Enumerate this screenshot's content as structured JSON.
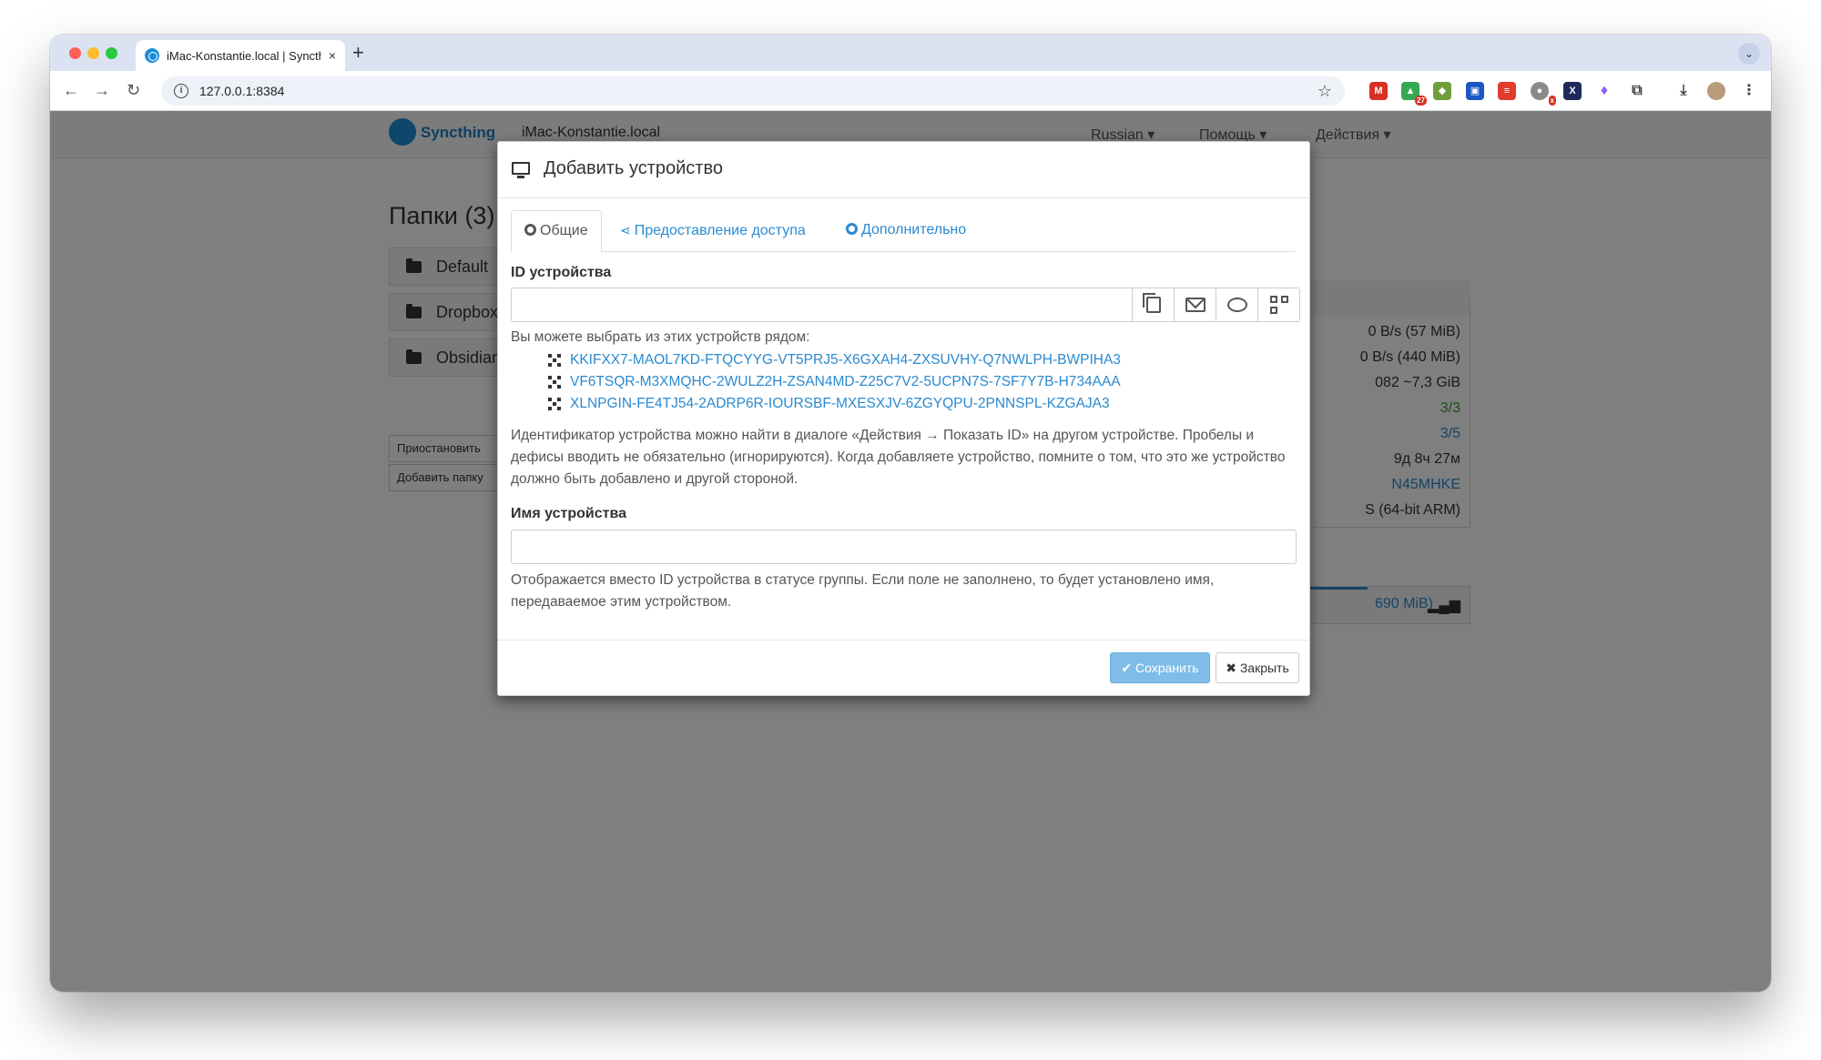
{
  "browser": {
    "tab_title": "iMac-Konstantie.local | Syncthing",
    "url": "127.0.0.1:8384",
    "new_tab": "+",
    "tab_close": "×",
    "ext_badge_count": "27",
    "ext_badge_x": "x"
  },
  "app": {
    "brand": "Syncthing",
    "host": "iMac-Konstantie.local",
    "menu_language": "Russian ▾",
    "menu_help": "Помощь ▾",
    "menu_actions": "Действия ▾",
    "folders_heading": "Папки (3)",
    "folders": [
      "Default",
      "Dropbox",
      "Obsidian"
    ],
    "pause_btn": "Приостановить",
    "add_folder_btn": "Добавить папку"
  },
  "right_panel": {
    "download": "0 B/s (57 MiB)",
    "upload": "0 B/s (440 MiB)",
    "local_state": "082  ~7,3 GiB",
    "listeners": "3/3",
    "discovery": "3/5",
    "uptime": "9д 8ч 27м",
    "id": "N45MHKE",
    "version": "S (64-bit ARM)",
    "device_summary": "690 MiB)"
  },
  "modal": {
    "title": "Добавить устройство",
    "tabs": [
      "Общие",
      "Предоставление доступа",
      "Дополнительно"
    ],
    "device_id_label": "ID устройства",
    "device_id_value": "",
    "nearby_intro": "Вы можете выбрать из этих устройств рядом:",
    "nearby_devices": [
      "KKIFXX7-MAOL7KD-FTQCYYG-VT5PRJ5-X6GXAH4-ZXSUVHY-Q7NWLPH-BWPIHA3",
      "VF6TSQR-M3XMQHC-2WULZ2H-ZSAN4MD-Z25C7V2-5UCPN7S-7SF7Y7B-H734AAA",
      "XLNPGIN-FE4TJ54-2ADRP6R-IOURSBF-MXESXJV-6ZGYQPU-2PNNSPL-KZGAJA3"
    ],
    "device_id_help": "Идентификатор устройства можно найти в диалоге «Действия → Показать ID» на другом устройстве. Пробелы и дефисы вводить не обязательно (игнорируются). Когда добавляете устройство, помните о том, что это же устройство должно быть добавлено и другой стороной.",
    "device_name_label": "Имя устройства",
    "device_name_value": "",
    "device_name_help": "Отображается вместо ID устройства в статусе группы. Если поле не заполнено, то будет установлено имя, передаваемое этим устройством.",
    "save_label": "✔ Сохранить",
    "close_label": "✖ Закрыть"
  },
  "colors": {
    "link": "#2a8ad0",
    "save_button": "#7fbde8",
    "brand": "#1a7fc4"
  }
}
